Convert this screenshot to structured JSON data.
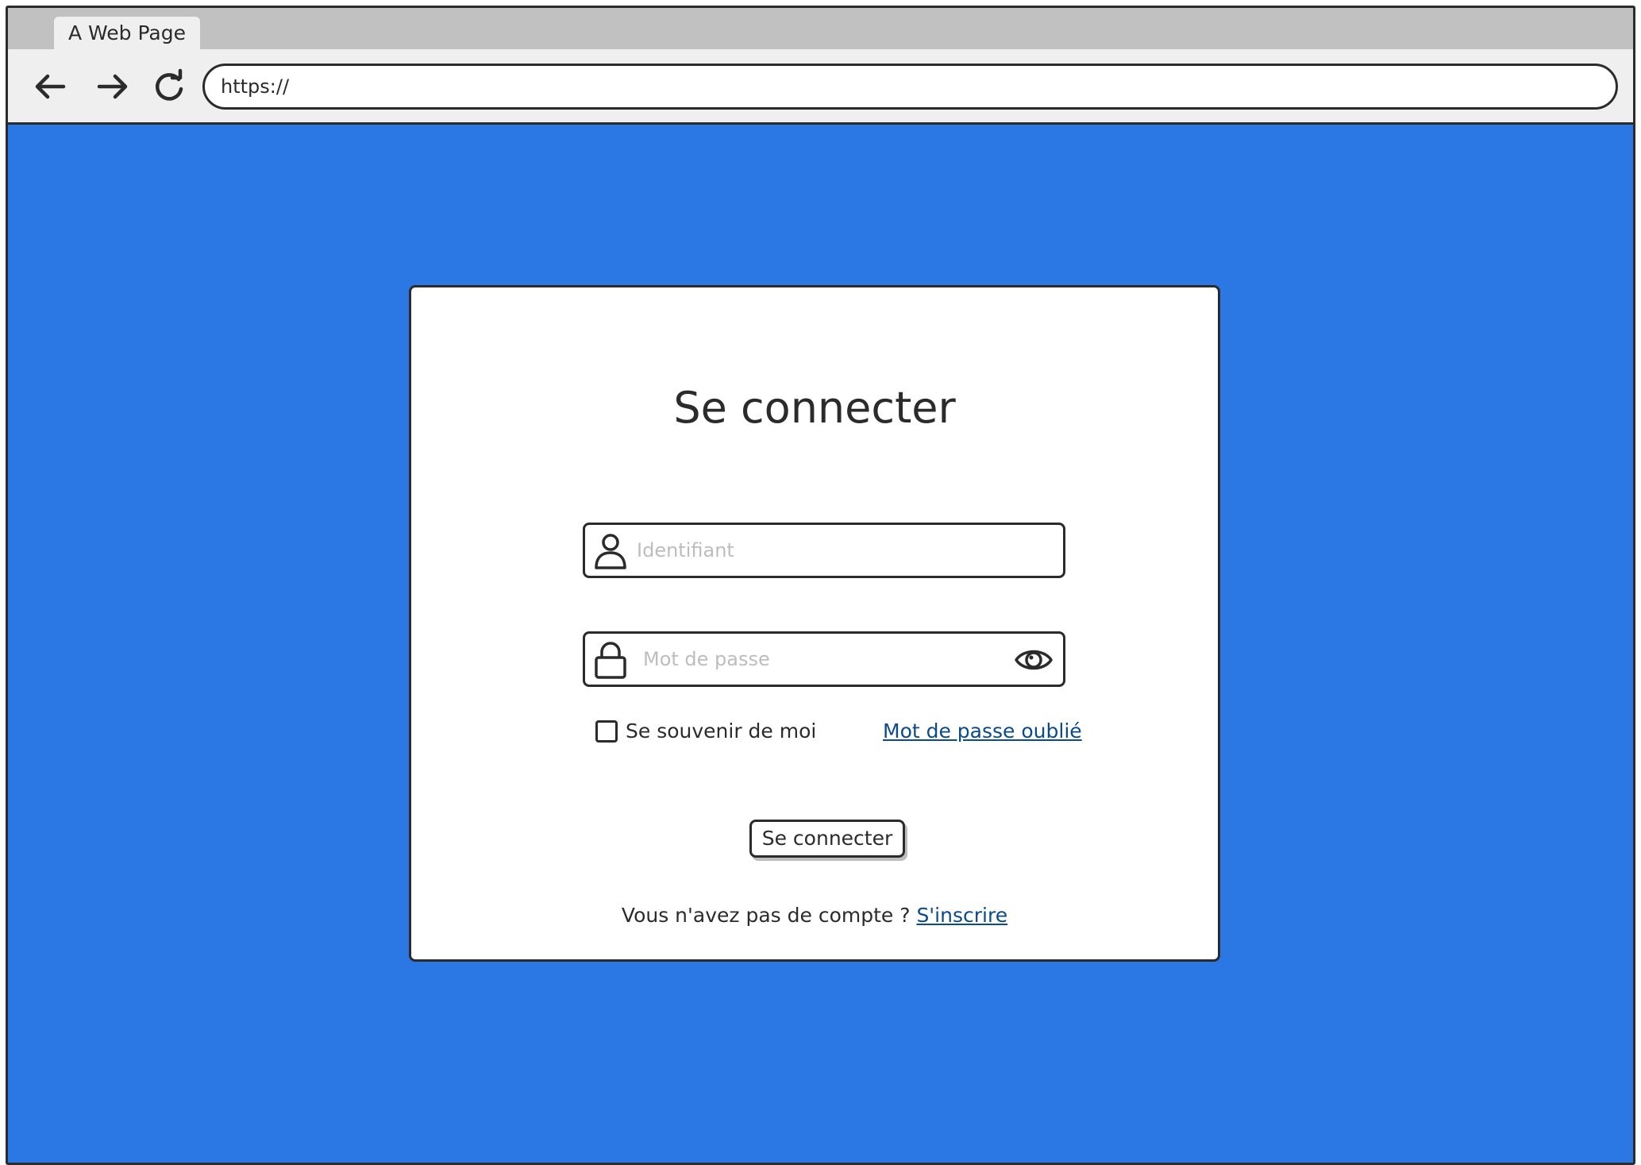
{
  "browser": {
    "tab_title": "A Web Page",
    "url": "https://"
  },
  "icons": {
    "back": "arrow-left-icon",
    "forward": "arrow-right-icon",
    "reload": "reload-icon",
    "user": "user-icon",
    "lock": "lock-icon",
    "eye": "eye-icon"
  },
  "colors": {
    "background": "#2b78e4",
    "link": "#0b4a8b",
    "placeholder": "#bdbdbd"
  },
  "login": {
    "title": "Se connecter",
    "username_placeholder": "Identifiant",
    "password_placeholder": "Mot de passe",
    "remember_label": "Se souvenir de moi",
    "remember_checked": false,
    "forgot_link": "Mot de passe oublié",
    "submit_label": "Se connecter",
    "no_account_text": "Vous n'avez pas de compte ?",
    "signup_link": "S'inscrire"
  }
}
